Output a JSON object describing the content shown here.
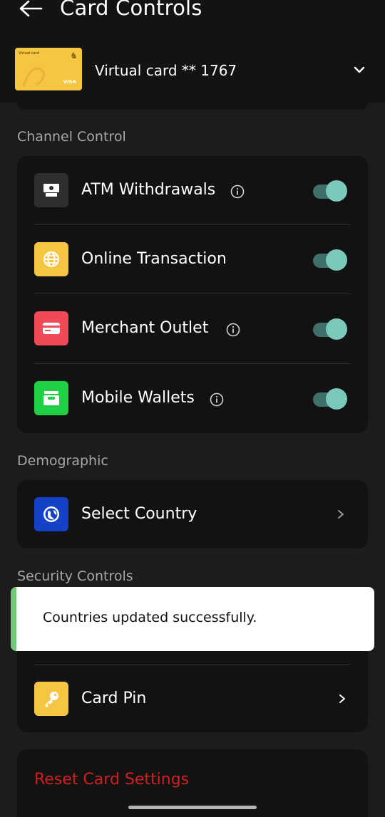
{
  "header": {
    "title": "Card Controls",
    "back_icon": "arrow-left-icon",
    "card": {
      "thumbnail_brand": "Virtual card",
      "thumbnail_network": "VISA",
      "name": "Virtual card ** 1767",
      "chevron_icon": "chevron-down-icon"
    }
  },
  "channel_control": {
    "label": "Channel Control",
    "items": [
      {
        "label": "ATM Withdrawals",
        "icon": "atm-icon",
        "icon_bg": "#2e2e2e",
        "has_info": true,
        "enabled": true
      },
      {
        "label": "Online Transaction",
        "icon": "globe-icon",
        "icon_bg": "#f6c642",
        "has_info": false,
        "enabled": true
      },
      {
        "label": "Merchant Outlet",
        "icon": "credit-card-icon",
        "icon_bg": "#ef4a55",
        "has_info": true,
        "enabled": true
      },
      {
        "label": "Mobile Wallets",
        "icon": "wallet-icon",
        "icon_bg": "#1fd045",
        "has_info": true,
        "enabled": true
      }
    ]
  },
  "demographic": {
    "label": "Demographic",
    "select_country": {
      "label": "Select Country",
      "icon": "globe-icon",
      "icon_bg": "#1441c7"
    }
  },
  "security_controls": {
    "label": "Security Controls",
    "card_pin": {
      "label": "Card Pin",
      "icon": "key-icon",
      "icon_bg": "#f6c642"
    }
  },
  "toast": {
    "message": "Countries updated successfully.",
    "accent_color": "#71c87a"
  },
  "reset": {
    "label": "Reset Card Settings",
    "color": "#d31f1f"
  },
  "colors": {
    "background": "#1c1c1c",
    "panel": "#121212",
    "toggle_on": "#7bc8bd"
  }
}
